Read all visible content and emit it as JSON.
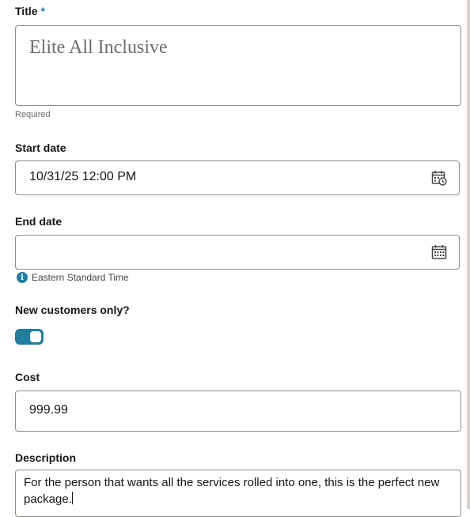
{
  "title_field": {
    "label": "Title",
    "required_marker": "*",
    "value": "Elite All Inclusive",
    "helper": "Required"
  },
  "start_date_field": {
    "label": "Start date",
    "value": "10/31/25 12:00 PM",
    "icon": "calendar-clock-icon"
  },
  "end_date_field": {
    "label": "End date",
    "value": "",
    "icon": "calendar-icon",
    "timezone_note": "Eastern Standard Time",
    "timezone_icon": "info-icon"
  },
  "new_customers_field": {
    "label": "New customers only?",
    "toggle_on": true
  },
  "cost_field": {
    "label": "Cost",
    "value": "999.99"
  },
  "description_field": {
    "label": "Description",
    "value": "For the person that wants all the services rolled into one, this is the perfect new package."
  },
  "colors": {
    "accent": "#227e9e",
    "border": "#8f8c88",
    "text": "#161513",
    "muted": "#6f6c68"
  }
}
